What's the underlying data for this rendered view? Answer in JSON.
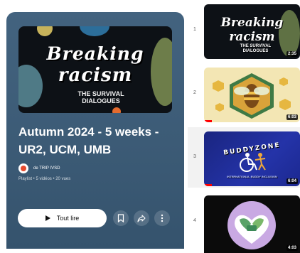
{
  "playlist": {
    "title": "Autumn 2024 - 5 weeks - UR2, UCM, UMB",
    "owner": "de TRIP IVSD",
    "meta": "Playlist • 5 vidéos • 20 vues",
    "hero": {
      "line1": "Breaking",
      "line2": "racism",
      "subtitle": "THE SURVIVAL DIALOGUES"
    },
    "play_all_label": "Tout lire",
    "icons": {
      "play": "play-icon",
      "save": "bookmark-icon",
      "share": "share-icon",
      "more": "more-vert-icon"
    }
  },
  "videos": [
    {
      "index": "1",
      "duration": "2:35",
      "thumb_line1": "Breaking",
      "thumb_line2": "racism",
      "thumb_sub": "THE SURVIVAL DIALOGUES",
      "progress": 0
    },
    {
      "index": "2",
      "duration": "6:03",
      "progress": 0.08
    },
    {
      "index": "3",
      "duration": "6:04",
      "thumb_title": "BUDDYZONE",
      "thumb_tagline": "INTERNATIONAL BUDDY INCLUSION",
      "progress": 0.08
    },
    {
      "index": "4",
      "duration": "4:03",
      "progress": 0
    }
  ],
  "colors": {
    "header_bg": "#3c5b76",
    "progress": "#ff0000",
    "buddyzone_bg": "#1f2b8f",
    "bee_bg": "#f3e6b4"
  }
}
